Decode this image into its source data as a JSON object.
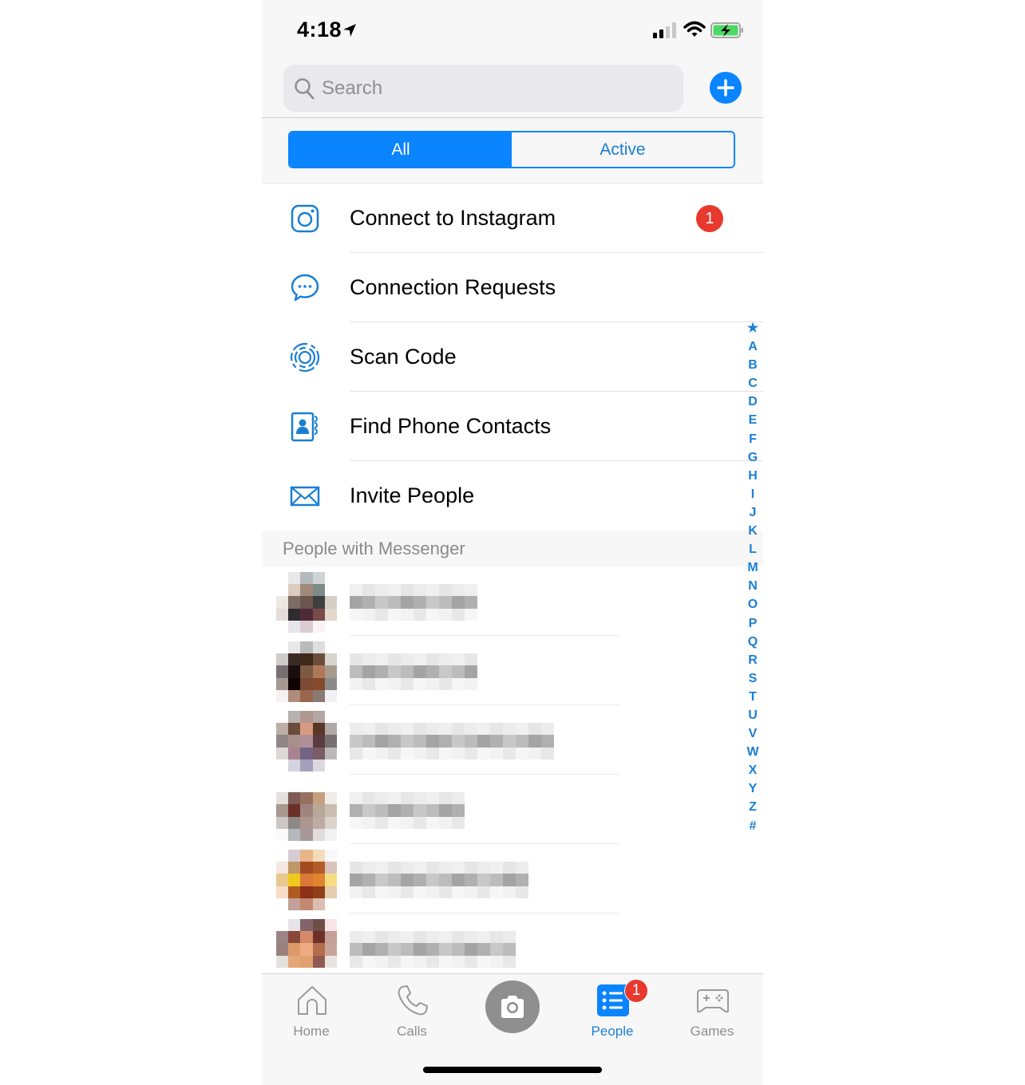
{
  "status_bar": {
    "time": "4:18",
    "location_icon": "location-arrow-icon",
    "signal_bars": 2,
    "signal_total": 4,
    "battery": "charging"
  },
  "header": {
    "search": {
      "placeholder": "Search",
      "value": ""
    },
    "compose_icon": "plus-icon"
  },
  "segmented": {
    "options": [
      "All",
      "Active"
    ],
    "selected": "All"
  },
  "actions": [
    {
      "label": "Connect to Instagram",
      "icon": "instagram-icon",
      "badge": "1"
    },
    {
      "label": "Connection Requests",
      "icon": "chat-bubble-icon",
      "badge": null
    },
    {
      "label": "Scan Code",
      "icon": "scan-code-icon",
      "badge": null
    },
    {
      "label": "Find Phone Contacts",
      "icon": "contacts-book-icon",
      "badge": null
    },
    {
      "label": "Invite People",
      "icon": "envelope-icon",
      "badge": null
    }
  ],
  "section_header": "People with Messenger",
  "people": {
    "count_visible": 6,
    "redacted": true
  },
  "index": [
    "★",
    "A",
    "B",
    "C",
    "D",
    "E",
    "F",
    "G",
    "H",
    "I",
    "J",
    "K",
    "L",
    "M",
    "N",
    "O",
    "P",
    "Q",
    "R",
    "S",
    "T",
    "U",
    "V",
    "W",
    "X",
    "Y",
    "Z",
    "#"
  ],
  "tabbar": {
    "tabs": [
      {
        "label": "Home",
        "icon": "home-icon",
        "active": false
      },
      {
        "label": "Calls",
        "icon": "phone-icon",
        "active": false
      },
      {
        "label": "",
        "icon": "camera-icon",
        "active": false
      },
      {
        "label": "People",
        "icon": "people-list-icon",
        "active": true,
        "badge": "1"
      },
      {
        "label": "Games",
        "icon": "gamepad-icon",
        "active": false
      }
    ]
  },
  "colors": {
    "accent": "#0a84ff",
    "link": "#1a7fd4",
    "badge": "#e8392f",
    "muted": "#8e8e93"
  }
}
